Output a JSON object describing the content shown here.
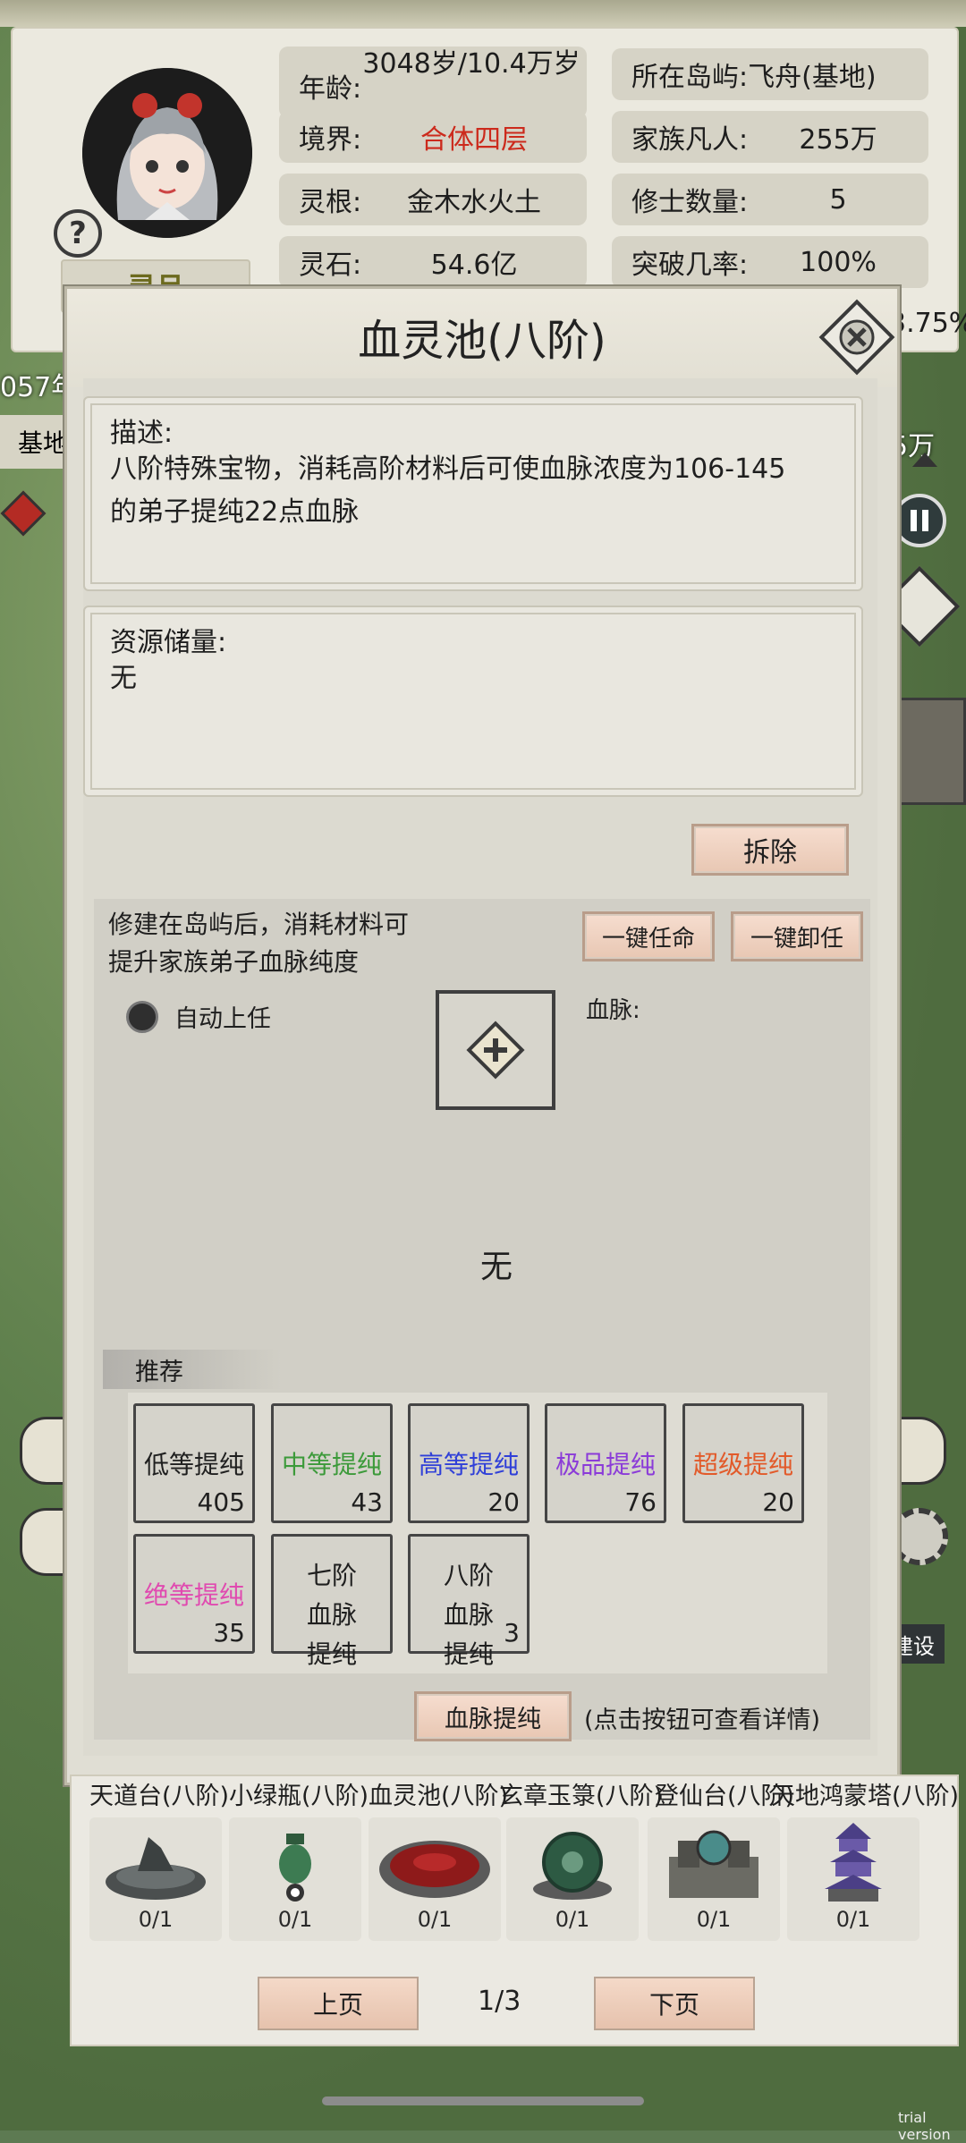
{
  "colors": {
    "realm": "#cc2a1c",
    "name": "#6c6a1e",
    "low": "#1f1f1f",
    "mid": "#3c9a3a",
    "high": "#2f3fd8",
    "top": "#8b3bd8",
    "super": "#e25a2a",
    "ultimate": "#e04ab0"
  },
  "character": {
    "name": "灵月",
    "help_icon": "question-icon",
    "stats_left": [
      {
        "label": "年龄:",
        "value": "3048岁/10.4万岁"
      },
      {
        "label": "境界:",
        "value": "合体四层"
      },
      {
        "label": "灵根:",
        "value": "金木水火土"
      },
      {
        "label": "灵石:",
        "value": "54.6亿"
      }
    ],
    "stats_right": [
      {
        "label": "所在岛屿:",
        "value": "飞舟(基地)"
      },
      {
        "label": "家族凡人:",
        "value": "255万"
      },
      {
        "label": "修士数量:",
        "value": "5"
      },
      {
        "label": "突破几率:",
        "value": "100%"
      }
    ],
    "peek_rate": "3.75%"
  },
  "background": {
    "year_fragment": "057年",
    "base_fragment": "基地",
    "right_fragment": "5万",
    "build_tag": "建设"
  },
  "modal": {
    "title": "血灵池(八阶)",
    "description_title": "描述:",
    "description_text": "八阶特殊宝物，消耗高阶材料后可使血脉浓度为106-145的弟子提纯22点血脉",
    "resource_title": "资源储量:",
    "resource_value": "无",
    "dismantle_label": "拆除",
    "build_hint": "修建在岛屿后，消耗材料可提升家族弟子血脉纯度",
    "appoint_all_label": "一键任命",
    "dismiss_all_label": "一键卸任",
    "auto_appoint_label": "自动上任",
    "bloodline_label": "血脉:",
    "empty_text": "无",
    "recommend_title": "推荐",
    "recommend": [
      {
        "label": "低等提纯",
        "count": "405"
      },
      {
        "label": "中等提纯",
        "count": "43"
      },
      {
        "label": "高等提纯",
        "count": "20"
      },
      {
        "label": "极品提纯",
        "count": "76"
      },
      {
        "label": "超级提纯",
        "count": "20"
      },
      {
        "label": "绝等提纯",
        "count": "35"
      },
      {
        "label": "七阶血脉提纯",
        "count": ""
      },
      {
        "label": "八阶血脉提纯",
        "count": "3"
      }
    ],
    "purify_label": "血脉提纯",
    "purify_hint": "(点击按钮可查看详情)"
  },
  "buildings": {
    "items": [
      {
        "name": "天道台(八阶)",
        "count": "0/1"
      },
      {
        "name": "小绿瓶(八阶)",
        "count": "0/1"
      },
      {
        "name": "血灵池(八阶)",
        "count": "0/1"
      },
      {
        "name": "玄章玉箓(八阶)",
        "count": "0/1"
      },
      {
        "name": "登仙台(八阶)",
        "count": "0/1"
      },
      {
        "name": "天地鸿蒙塔(八阶)",
        "count": "0/1"
      }
    ],
    "prev_label": "上页",
    "next_label": "下页",
    "page": "1/3"
  },
  "watermark": "trial version"
}
